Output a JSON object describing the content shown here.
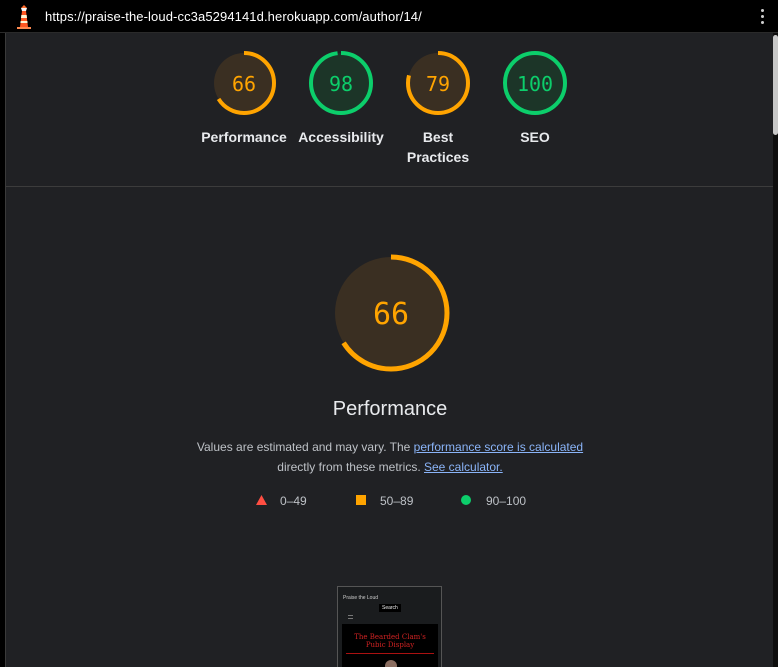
{
  "browser": {
    "url": "https://praise-the-loud-cc3a5294141d.herokuapp.com/author/14/",
    "logo_icon": "lighthouse-icon",
    "menu_icon": "more-vertical-icon"
  },
  "colors": {
    "average": "#ffa400",
    "pass": "#0cce6b",
    "fail": "#ff4e42",
    "average_bg": "#3b2f20",
    "pass_bg": "#1f3a2c"
  },
  "summary": {
    "gauges": [
      {
        "score": "66",
        "label": "Performance",
        "status": "average"
      },
      {
        "score": "98",
        "label": "Accessibility",
        "status": "pass"
      },
      {
        "score": "79",
        "label_line1": "Best",
        "label_line2": "Practices",
        "status": "average"
      },
      {
        "score": "100",
        "label": "SEO",
        "status": "pass"
      }
    ]
  },
  "performance": {
    "score": "66",
    "title": "Performance",
    "desc_prefix": "Values are estimated and may vary. The ",
    "desc_link1": "performance score is calculated",
    "desc_middle": "directly from these metrics.",
    "desc_link2": "See calculator.",
    "legend": [
      {
        "range": "0–49",
        "shape": "triangle"
      },
      {
        "range": "50–89",
        "shape": "square"
      },
      {
        "range": "90–100",
        "shape": "circle"
      }
    ]
  },
  "screenshot_thumb": {
    "site_title": "Praise the Loud",
    "search_label": "Search",
    "banner_line1": "The Bearded Clam's",
    "banner_line2": "Pubic Display"
  }
}
